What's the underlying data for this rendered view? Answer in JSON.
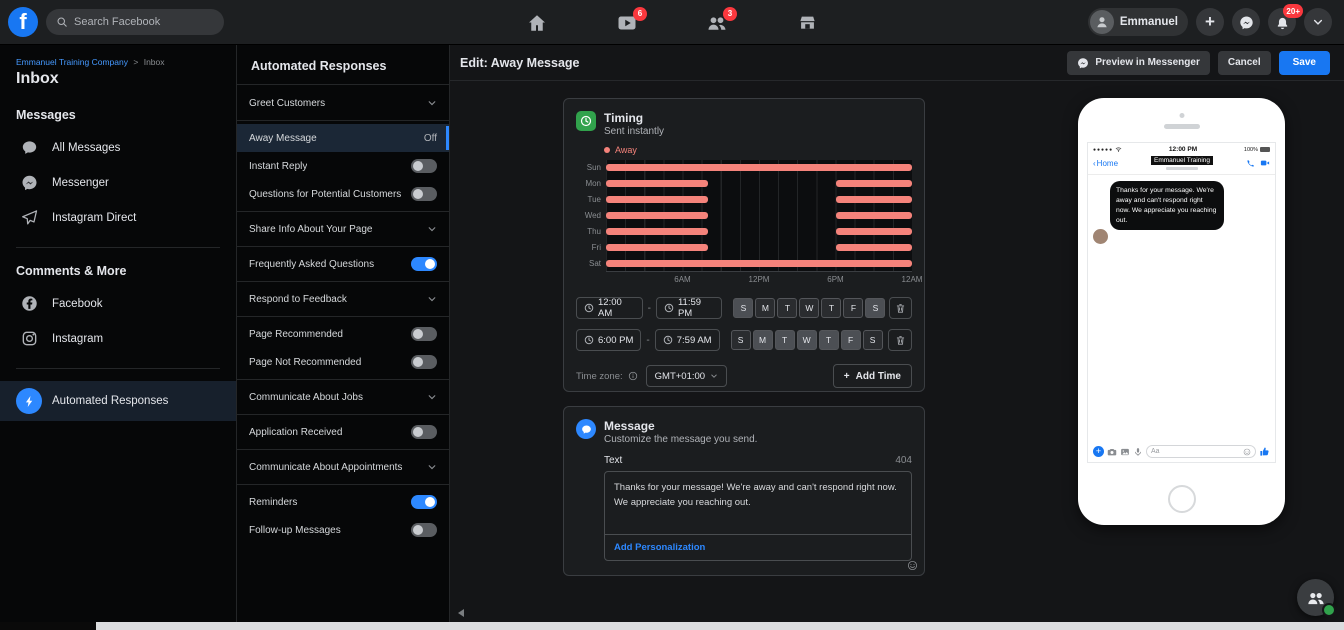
{
  "colors": {
    "accent_blue": "#2d88ff",
    "save_blue": "#1877f2",
    "bar_red": "#f5837b",
    "toggle_on": "#2d88ff",
    "badge_red": "#fa383e",
    "online_green": "#31a24c"
  },
  "topbar": {
    "search_placeholder": "Search Facebook",
    "watch_badge": "6",
    "groups_badge": "3",
    "profile_name": "Emmanuel",
    "notifications_badge": "20+"
  },
  "sidebar": {
    "breadcrumb_company": "Emmanuel Training Company",
    "breadcrumb_separator": ">",
    "breadcrumb_current": "Inbox",
    "title": "Inbox",
    "messages_header": "Messages",
    "messages_items": [
      {
        "label": "All Messages",
        "icon": "chat"
      },
      {
        "label": "Messenger",
        "icon": "messenger"
      },
      {
        "label": "Instagram Direct",
        "icon": "plane"
      }
    ],
    "comments_header": "Comments & More",
    "comments_items": [
      {
        "label": "Facebook",
        "icon": "facebook"
      },
      {
        "label": "Instagram",
        "icon": "instagram"
      }
    ],
    "automation_item": {
      "label": "Automated Responses",
      "icon": "bolt"
    }
  },
  "panel": {
    "title": "Automated Responses",
    "items": [
      {
        "label": "Greet Customers",
        "control": "chevron",
        "divider_after": true
      },
      {
        "label": "Away Message",
        "control": "status",
        "status": "Off",
        "selected": true
      },
      {
        "label": "Instant Reply",
        "control": "toggle",
        "on": false
      },
      {
        "label": "Questions for Potential Customers",
        "control": "toggle",
        "on": false,
        "divider_after": true
      },
      {
        "label": "Share Info About Your Page",
        "control": "chevron",
        "divider_after": true
      },
      {
        "label": "Frequently Asked Questions",
        "control": "toggle",
        "on": true,
        "divider_after": true
      },
      {
        "label": "Respond to Feedback",
        "control": "chevron",
        "divider_after": true
      },
      {
        "label": "Page Recommended",
        "control": "toggle",
        "on": false
      },
      {
        "label": "Page Not Recommended",
        "control": "toggle",
        "on": false,
        "divider_after": true
      },
      {
        "label": "Communicate About Jobs",
        "control": "chevron",
        "divider_after": true
      },
      {
        "label": "Application Received",
        "control": "toggle",
        "on": false,
        "divider_after": true
      },
      {
        "label": "Communicate About Appointments",
        "control": "chevron",
        "divider_after": true
      },
      {
        "label": "Reminders",
        "control": "toggle",
        "on": true
      },
      {
        "label": "Follow-up Messages",
        "control": "toggle",
        "on": false
      }
    ]
  },
  "editor": {
    "title": "Edit: Away Message",
    "preview_button": "Preview in Messenger",
    "cancel_button": "Cancel",
    "save_button": "Save",
    "timing": {
      "title": "Timing",
      "subtitle": "Sent instantly",
      "legend_label": "Away",
      "schedules": [
        {
          "start": "12:00 AM",
          "end": "11:59 PM",
          "days": [
            "S",
            "M",
            "T",
            "W",
            "T",
            "F",
            "S"
          ],
          "selected": [
            true,
            false,
            false,
            false,
            false,
            false,
            true
          ]
        },
        {
          "start": "6:00 PM",
          "end": "7:59 AM",
          "days": [
            "S",
            "M",
            "T",
            "W",
            "T",
            "F",
            "S"
          ],
          "selected": [
            false,
            true,
            true,
            true,
            true,
            true,
            false
          ]
        }
      ],
      "timezone_label": "Time zone:",
      "timezone_value": "GMT+01:00",
      "add_time_label": "Add Time"
    },
    "message": {
      "title": "Message",
      "subtitle": "Customize the message you send.",
      "field_label": "Text",
      "chars_remaining": "404",
      "value": "Thanks for your message! We're away and can't respond right now. We appreciate you reaching out.",
      "personalization_label": "Add Personalization"
    }
  },
  "phone": {
    "status_time": "12:00 PM",
    "battery": "100%",
    "back_label": "Home",
    "contact_name": "Emmanuel Training",
    "bubble_text": "Thanks for your message. We're away and can't respond right now. We appreciate you reaching out.",
    "composer_placeholder": "Aa"
  },
  "chart_data": {
    "type": "gantt",
    "title": "Away schedule by day and hour",
    "days": [
      "Sun",
      "Mon",
      "Tue",
      "Wed",
      "Thu",
      "Fri",
      "Sat"
    ],
    "x_ticks": [
      "6AM",
      "12PM",
      "6PM",
      "12AM"
    ],
    "x_unit": "hour-of-day",
    "x_range": [
      0,
      24
    ],
    "legend": [
      {
        "name": "Away",
        "color": "#f5837b"
      }
    ],
    "series": [
      {
        "name": "Away",
        "intervals": [
          {
            "day": "Sun",
            "start": 0,
            "end": 24
          },
          {
            "day": "Mon",
            "start": 0,
            "end": 8
          },
          {
            "day": "Mon",
            "start": 18,
            "end": 24
          },
          {
            "day": "Tue",
            "start": 0,
            "end": 8
          },
          {
            "day": "Tue",
            "start": 18,
            "end": 24
          },
          {
            "day": "Wed",
            "start": 0,
            "end": 8
          },
          {
            "day": "Wed",
            "start": 18,
            "end": 24
          },
          {
            "day": "Thu",
            "start": 0,
            "end": 8
          },
          {
            "day": "Thu",
            "start": 18,
            "end": 24
          },
          {
            "day": "Fri",
            "start": 0,
            "end": 8
          },
          {
            "day": "Fri",
            "start": 18,
            "end": 24
          },
          {
            "day": "Sat",
            "start": 0,
            "end": 24
          }
        ]
      }
    ]
  }
}
